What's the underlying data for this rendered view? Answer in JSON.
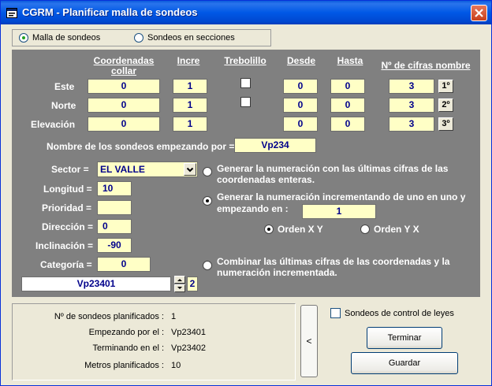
{
  "window": {
    "title": "CGRM - Planificar malla de sondeos"
  },
  "mode": {
    "option1": "Malla de sondeos",
    "option2": "Sondeos en secciones",
    "selected": "option1"
  },
  "headers": {
    "coord": "Coordenadas collar",
    "incre": "Incre",
    "tres": "Trebolillo",
    "desde": "Desde",
    "hasta": "Hasta",
    "cifras": "Nº de cifras nombre"
  },
  "rows": [
    {
      "label": "Este",
      "coord": "0",
      "incre": "1",
      "desde": "0",
      "hasta": "0",
      "cifras": "3",
      "order": "1º"
    },
    {
      "label": "Norte",
      "coord": "0",
      "incre": "1",
      "desde": "0",
      "hasta": "0",
      "cifras": "3",
      "order": "2º"
    },
    {
      "label": "Elevación",
      "coord": "0",
      "incre": "1",
      "desde": "0",
      "hasta": "0",
      "cifras": "3",
      "order": "3º"
    }
  ],
  "nombre": {
    "label": "Nombre de los sondeos empezando por =",
    "value": "Vp234"
  },
  "props": {
    "sector_label": "Sector =",
    "sector_value": "EL VALLE",
    "longitud_label": "Longitud =",
    "longitud_value": "10",
    "prioridad_label": "Prioridad =",
    "prioridad_value": "",
    "direccion_label": "Dirección =",
    "direccion_value": "0",
    "inclinacion_label": "Inclinación =",
    "inclinacion_value": "-90",
    "categoria_label": "Categoría =",
    "categoria_value": "0"
  },
  "namepreview": {
    "value": "Vp23401",
    "spin": "2"
  },
  "numbering": {
    "opt1": "Generar la numeración con las últimas cifras de las coordenadas enteras.",
    "opt2_line1": "Generar la numeración incrementando de uno en uno y",
    "opt2_line2": "empezando en :",
    "start": "1",
    "orden_xy": "Orden X Y",
    "orden_yx": "Orden Y X",
    "opt3": "Combinar las últimas cifras de las coordenadas y la numeración incrementada.",
    "selected": "opt2",
    "orden_selected": "xy"
  },
  "summary": {
    "count_label": "Nº de sondeos planificados :",
    "count_value": "1",
    "start_label": "Empezando por el :",
    "start_value": "Vp23401",
    "end_label": "Terminando en el :",
    "end_value": "Vp23402",
    "meters_label": "Metros planificados :",
    "meters_value": "10"
  },
  "collapse": {
    "label": "<"
  },
  "control": {
    "label": "Sondeos de control de leyes"
  },
  "buttons": {
    "terminar": "Terminar",
    "guardar": "Guardar"
  }
}
